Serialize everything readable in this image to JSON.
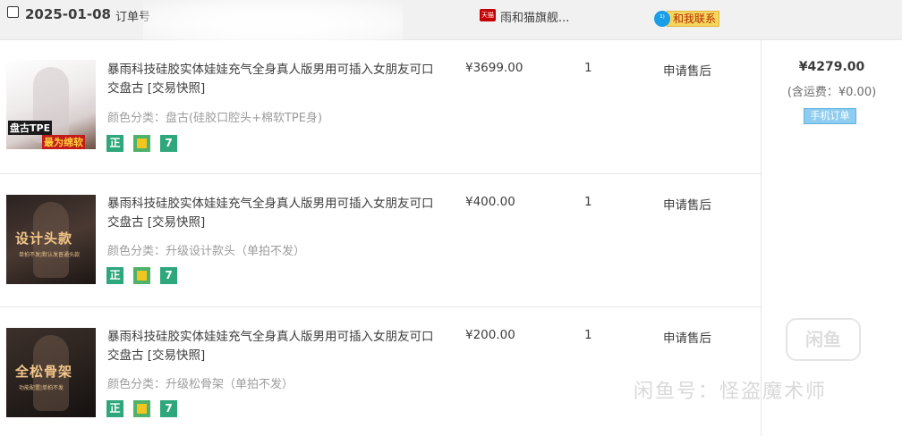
{
  "order": {
    "date": "2025-01-08",
    "order_no_label": "订单号",
    "store_badge": "天猫",
    "store_name": "雨和猫旗舰...",
    "contact_label": "和我联系",
    "contact_icon": "chat-bubble-icon"
  },
  "summary": {
    "total": "¥4279.00",
    "shipping": "(含运费：¥0.00)",
    "mobile_order_label": "手机订单"
  },
  "items": [
    {
      "title": "暴雨科技硅胶实体娃娃充气全身真人版男用可插入女朋友可口交盘古 [交易快照]",
      "sku": "颜色分类：盘古(硅胶口腔头+棉软TPE身)",
      "thumb_text": "盘古TPE",
      "thumb_subtext": "最为绵软",
      "thumb_tiny": "",
      "price": "¥3699.00",
      "qty": "1",
      "after_sale": "申请售后",
      "badges": [
        "正",
        "",
        "7"
      ]
    },
    {
      "title": "暴雨科技硅胶实体娃娃充气全身真人版男用可插入女朋友可口交盘古 [交易快照]",
      "sku": "颜色分类：升级设计款头（单拍不发）",
      "thumb_text": "设计头款",
      "thumb_subtext": "",
      "thumb_tiny": "单拍不发|默认发普通头款",
      "price": "¥400.00",
      "qty": "1",
      "after_sale": "申请售后",
      "badges": [
        "正",
        "",
        "7"
      ]
    },
    {
      "title": "暴雨科技硅胶实体娃娃充气全身真人版男用可插入女朋友可口交盘古 [交易快照]",
      "sku": "颜色分类：升级松骨架（单拍不发）",
      "thumb_text": "全松骨架",
      "thumb_subtext": "",
      "thumb_tiny": "功能配置|单拍不发",
      "price": "¥200.00",
      "qty": "1",
      "after_sale": "申请售后",
      "badges": [
        "正",
        "",
        "7"
      ]
    }
  ],
  "watermark": {
    "logo": "闲鱼",
    "text": "闲鱼号：怪盗魔术师"
  }
}
